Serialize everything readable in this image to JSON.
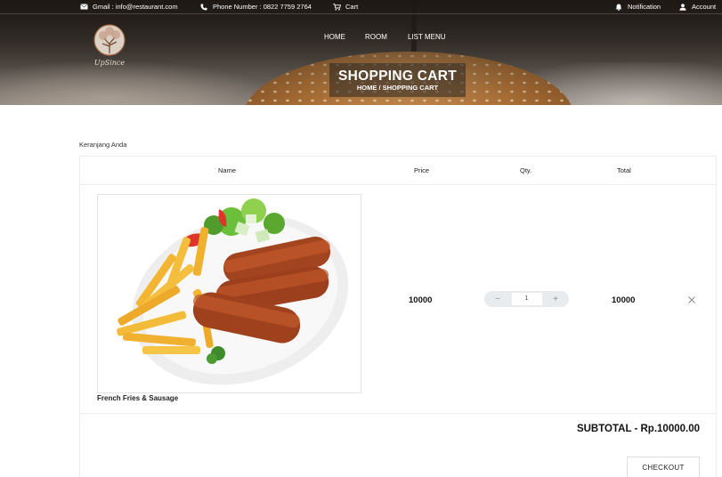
{
  "topbar": {
    "email": "Gmail : info@restaurant.com",
    "phone": "Phone Number : 0822 7759 2764",
    "cart": "Cart",
    "notification": "Notification",
    "account": "Account"
  },
  "logo": {
    "text": "UpSince"
  },
  "nav": {
    "items": [
      "HOME",
      "ROOM",
      "LIST MENU"
    ]
  },
  "page": {
    "title": "SHOPPING CART",
    "breadcrumb": "HOME / SHOPPING CART"
  },
  "cart": {
    "section_label": "Keranjang Anda",
    "headers": {
      "name": "Name",
      "price": "Price",
      "qty": "Qty.",
      "total": "Total"
    },
    "items": [
      {
        "name": "French Fries & Sausage",
        "price": "10000",
        "qty": "1",
        "total": "10000"
      }
    ],
    "qty_minus": "−",
    "qty_plus": "+",
    "remove_symbol": "×",
    "subtotal_label": "SUBTOTAL - ",
    "subtotal_value": "Rp.10000.00",
    "checkout_label": "CHECKOUT"
  }
}
